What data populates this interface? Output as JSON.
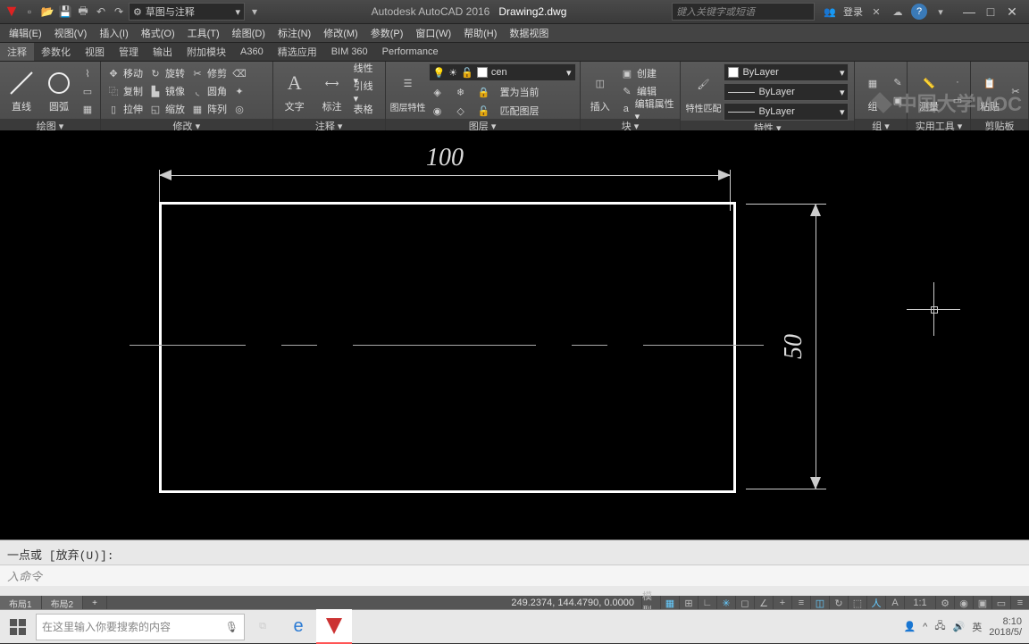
{
  "title": {
    "app": "Autodesk AutoCAD 2016",
    "file": "Drawing2.dwg"
  },
  "workspace_label": "草图与注释",
  "qat_arrow": "▾",
  "search_placeholder": "键入关键字或短语",
  "signin": "登录",
  "menus": [
    "编辑(E)",
    "视图(V)",
    "插入(I)",
    "格式(O)",
    "工具(T)",
    "绘图(D)",
    "标注(N)",
    "修改(M)",
    "参数(P)",
    "窗口(W)",
    "帮助(H)",
    "数据视图"
  ],
  "tabs": [
    "注释",
    "参数化",
    "视图",
    "管理",
    "输出",
    "附加模块",
    "A360",
    "精选应用",
    "BIM 360",
    "Performance"
  ],
  "ribbon": {
    "draw": {
      "line": "直线",
      "circle": "圆弧",
      "title": "绘图 ▾"
    },
    "modify": {
      "move": "移动",
      "rotate": "旋转",
      "trim": "修剪",
      "copy": "复制",
      "mirror": "镜像",
      "fillet": "圆角",
      "stretch": "拉伸",
      "scale": "缩放",
      "array": "阵列",
      "title": "修改 ▾"
    },
    "annot": {
      "text": "文字",
      "dim": "标注",
      "linear": "线性 ▾",
      "leader": "引线 ▾",
      "table": "表格",
      "title": "注释 ▾"
    },
    "layer": {
      "props": "图层特性",
      "dd": "cen",
      "current": "置为当前",
      "match": "匹配图层",
      "title": "图层 ▾"
    },
    "block": {
      "insert": "插入",
      "create": "创建",
      "edit": "编辑",
      "attr": "编辑属性 ▾",
      "title": "块 ▾"
    },
    "props": {
      "match": "特性匹配",
      "bylayer": "ByLayer",
      "title": "特性 ▾"
    },
    "group": {
      "group": "组",
      "title": "组 ▾"
    },
    "util": {
      "measure": "测量",
      "title": "实用工具 ▾"
    },
    "clip": {
      "paste": "粘贴",
      "title": "剪贴板"
    }
  },
  "drawing": {
    "dim_h": "100",
    "dim_v": "50"
  },
  "cmd": {
    "history": "一点或  [放弃(U)]:",
    "prompt": "入命令"
  },
  "layout_tabs": [
    "布局1",
    "布局2"
  ],
  "status": {
    "coords": "249.2374, 144.4790, 0.0000",
    "space": "模型",
    "scale": "1:1"
  },
  "taskbar": {
    "search_placeholder": "在这里输入你要搜索的内容",
    "ime": "英",
    "time": "8:10",
    "date": "2018/5/"
  },
  "watermark": "中国大学MOC",
  "icons": {
    "arrow": "▾",
    "plus": "+",
    "x": "✕",
    "min": "—",
    "max": "□",
    "help": "?",
    "gear": "⚙",
    "search": "🔍",
    "people": "👥",
    "mic": "🎤",
    "chevup": "^"
  }
}
